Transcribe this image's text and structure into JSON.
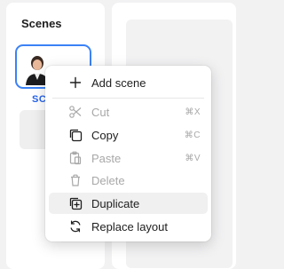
{
  "sidebar": {
    "title": "Scenes",
    "scene_label": "SC"
  },
  "context_menu": {
    "items": [
      {
        "label": "Add scene",
        "shortcut": "",
        "icon": "plus-icon",
        "disabled": false
      },
      {
        "label": "Cut",
        "shortcut": "⌘X",
        "icon": "scissors-icon",
        "disabled": true
      },
      {
        "label": "Copy",
        "shortcut": "⌘C",
        "icon": "copy-icon",
        "disabled": false
      },
      {
        "label": "Paste",
        "shortcut": "⌘V",
        "icon": "paste-icon",
        "disabled": true
      },
      {
        "label": "Delete",
        "shortcut": "",
        "icon": "trash-icon",
        "disabled": true
      },
      {
        "label": "Duplicate",
        "shortcut": "",
        "icon": "duplicate-icon",
        "disabled": false,
        "hovered": true
      },
      {
        "label": "Replace layout",
        "shortcut": "",
        "icon": "replace-layout-icon",
        "disabled": false
      }
    ]
  },
  "colors": {
    "accent": "#3b82f6",
    "disabled_text": "#a8a8a8",
    "hover_bg": "#f0f0f1"
  }
}
